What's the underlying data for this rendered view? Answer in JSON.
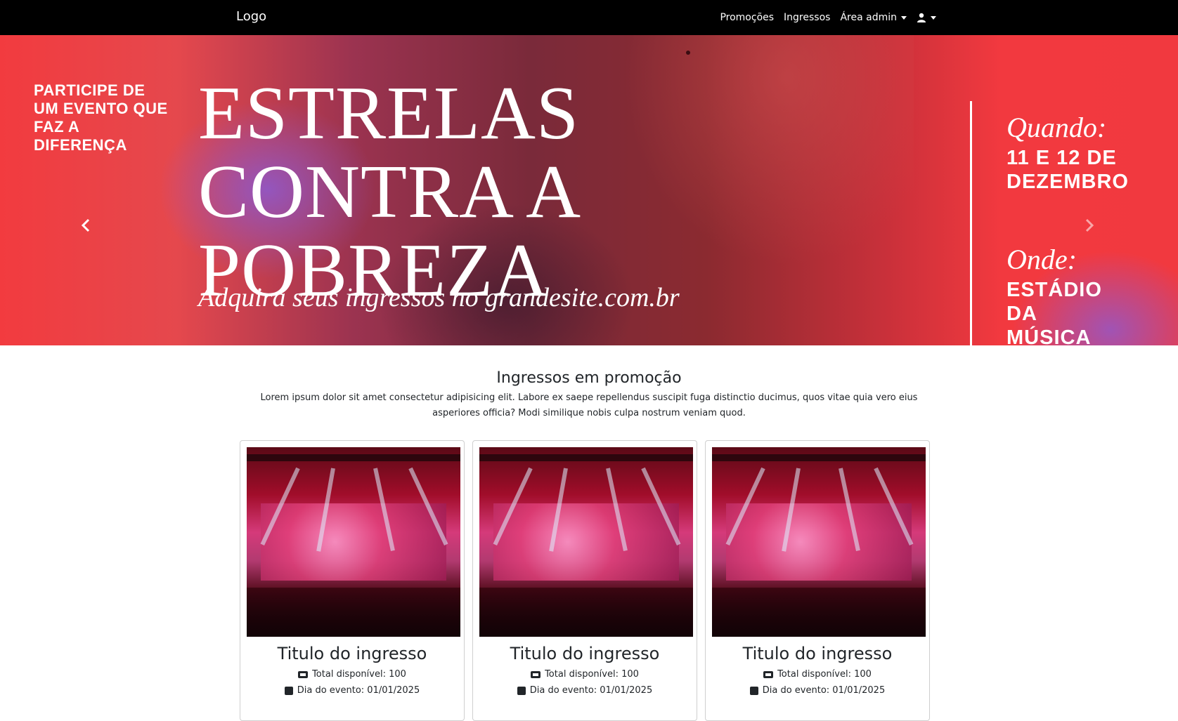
{
  "navbar": {
    "logo": "Logo",
    "links": [
      "Promoções",
      "Ingressos"
    ],
    "admin_label": "Área admin",
    "user_icon": "user-icon"
  },
  "hero": {
    "tagline": "PARTICIPE DE UM EVENTO QUE FAZ A DIFERENÇA",
    "title_line1": "ESTRELAS",
    "title_line2": "CONTRA A POBREZA",
    "subtitle": "Adquira seus ingressos no grandesite.com.br",
    "when_label": "Quando:",
    "when_value": "11 E 12 DE DEZEMBRO",
    "where_label": "Onde:",
    "where_value": "ESTÁDIO DA MÚSICA",
    "prev_icon": "chevron-left-icon",
    "next_icon": "chevron-right-icon"
  },
  "promo": {
    "title": "Ingressos em promoção",
    "description": "Lorem ipsum dolor sit amet consectetur adipisicing elit. Labore ex saepe repellendus suscipit fuga distinctio ducimus, quos vitae quia vero eius asperiores officia? Modi similique nobis culpa nostrum veniam quod."
  },
  "cards": [
    {
      "title": "Titulo do ingresso",
      "total": "Total disponível: 100",
      "date": "Dia do evento: 01/01/2025"
    },
    {
      "title": "Titulo do ingresso",
      "total": "Total disponível: 100",
      "date": "Dia do evento: 01/01/2025"
    },
    {
      "title": "Titulo do ingresso",
      "total": "Total disponível: 100",
      "date": "Dia do evento: 01/01/2025"
    }
  ],
  "colors": {
    "navbar": "#000000",
    "hero_red": "#f23b3f",
    "hero_purple": "#8c5ad2",
    "text": "#212529"
  }
}
